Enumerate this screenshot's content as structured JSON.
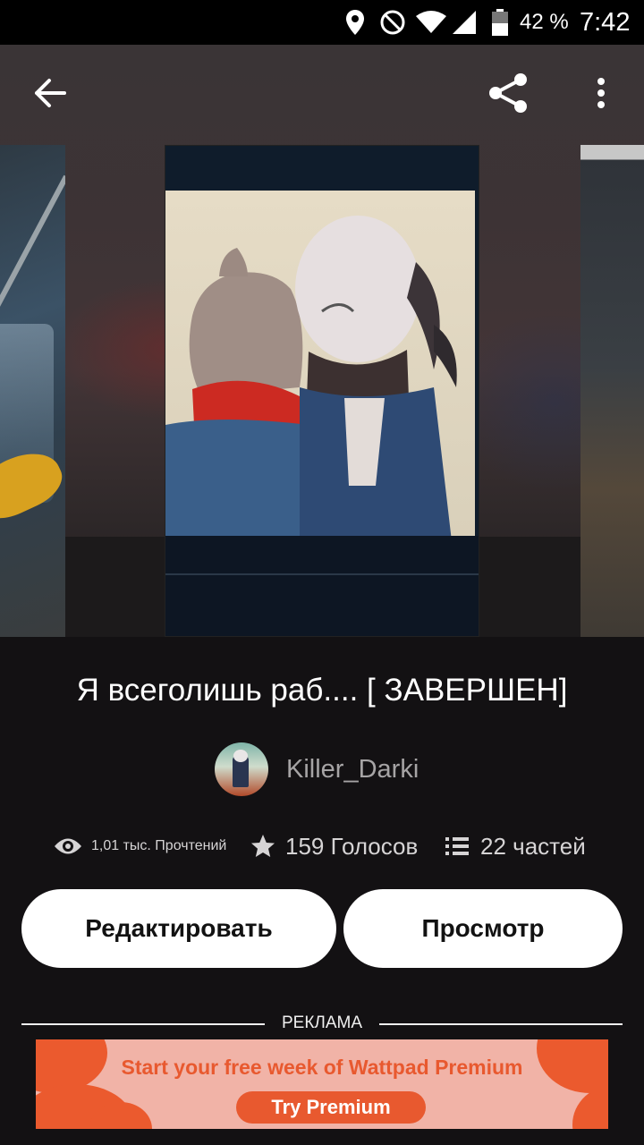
{
  "status_bar": {
    "battery_percent": "42 %",
    "time": "7:42"
  },
  "toolbar": {
    "back_icon": "arrow-left-icon",
    "share_icon": "share-icon",
    "menu_icon": "more-vertical-icon"
  },
  "story": {
    "title": "Я всеголишь раб.... [ ЗАВЕРШЕН]",
    "author": "Killer_Darki",
    "stats": {
      "reads": "1,01 тыс. Прочтений",
      "votes": "159 Голосов",
      "parts": "22 частей"
    }
  },
  "actions": {
    "edit_label": "Редактировать",
    "view_label": "Просмотр"
  },
  "ad": {
    "section_label": "РЕКЛАМА",
    "headline": "Start your free week of Wattpad Premium",
    "cta": "Try Premium"
  },
  "colors": {
    "background": "#131113",
    "accent": "#e8592f",
    "button_bg": "#ffffff"
  }
}
